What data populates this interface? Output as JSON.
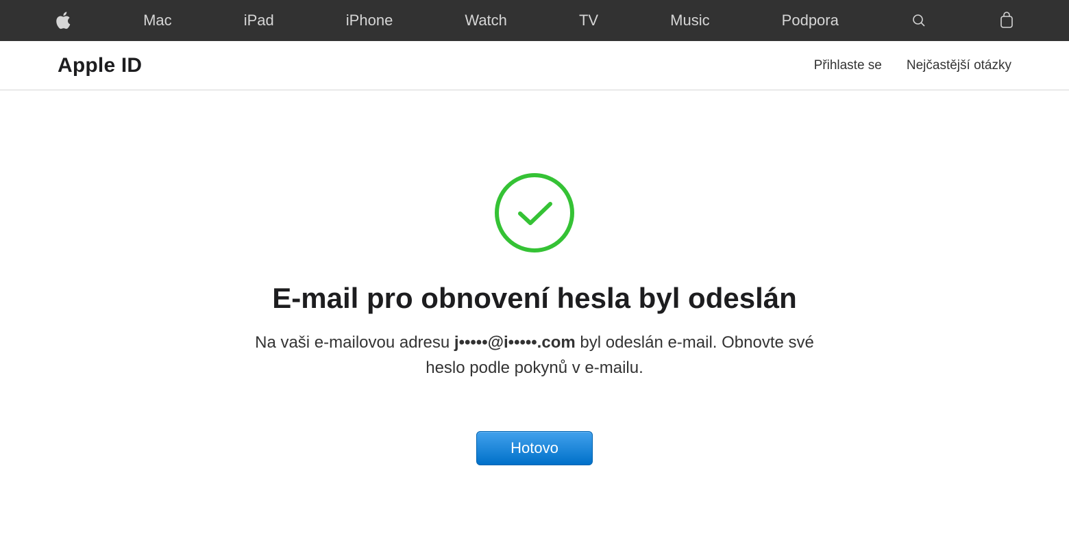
{
  "globalnav": {
    "items": [
      {
        "label": "Mac"
      },
      {
        "label": "iPad"
      },
      {
        "label": "iPhone"
      },
      {
        "label": "Watch"
      },
      {
        "label": "TV"
      },
      {
        "label": "Music"
      },
      {
        "label": "Podpora"
      }
    ]
  },
  "localnav": {
    "title": "Apple ID",
    "signin": "Přihlaste se",
    "faq": "Nejčastější otázky"
  },
  "content": {
    "headline": "E-mail pro obnovení hesla byl odeslán",
    "body_pre": "Na vaši e-mailovou adresu ",
    "body_email": "j•••••@i•••••.com",
    "body_post": " byl odeslán e-mail. Obnovte své heslo podle pokynů v e-mailu.",
    "done_button": "Hotovo"
  },
  "colors": {
    "success": "#35c235",
    "nav_bg": "#323232",
    "button_top": "#42a1ec",
    "button_bottom": "#0070c9"
  }
}
